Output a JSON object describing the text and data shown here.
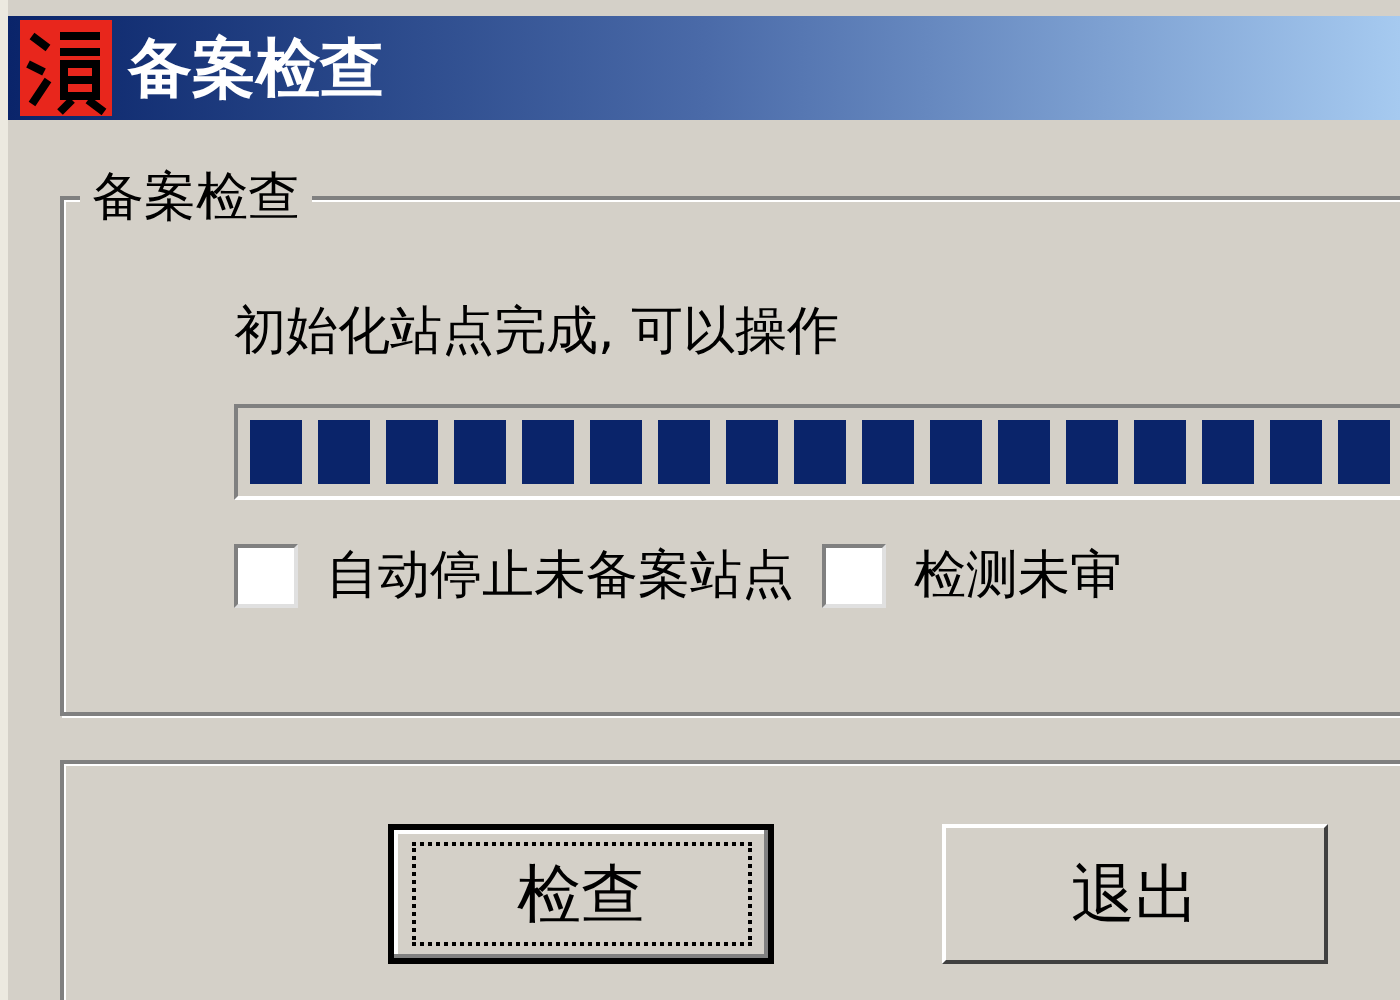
{
  "window": {
    "title": "备案检查"
  },
  "group": {
    "title": "备案检查",
    "status": "初始化站点完成, 可以操作",
    "progress": {
      "level": 1
    },
    "checkboxes": [
      {
        "label": "自动停止未备案站点",
        "checked": false
      },
      {
        "label": "检测未审",
        "checked": false
      }
    ]
  },
  "buttons": [
    {
      "label": "检查",
      "focused": true
    },
    {
      "label": "退出",
      "focused": false
    }
  ]
}
